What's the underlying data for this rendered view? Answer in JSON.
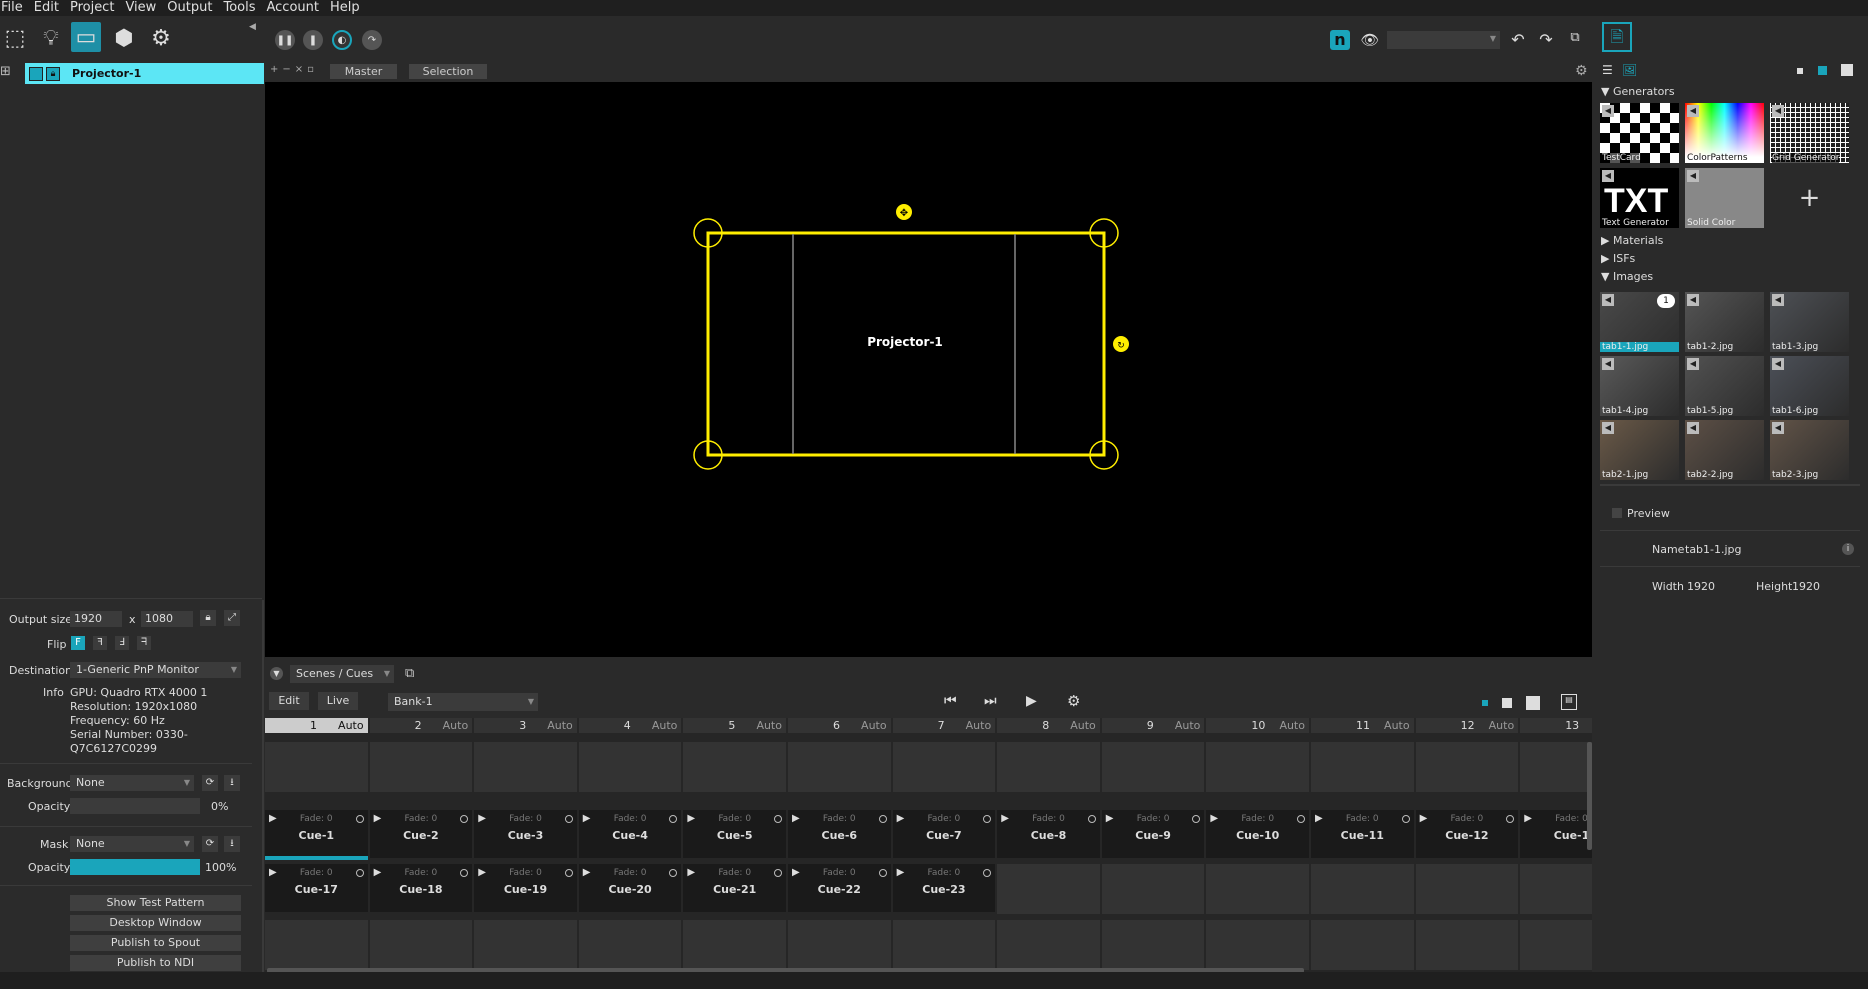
{
  "menu": [
    "File",
    "Edit",
    "Project",
    "View",
    "Output",
    "Tools",
    "Account",
    "Help"
  ],
  "layer": {
    "name": "Projector-1"
  },
  "viewport": {
    "tabs": [
      "Master",
      "Selection"
    ],
    "projector_label": "Projector-1"
  },
  "output": {
    "size_label": "Output size",
    "width": "1920",
    "x": "x",
    "height": "1080",
    "flip_label": "Flip",
    "destination_label": "Destination",
    "destination_value": "1-Generic PnP Monitor",
    "info_label": "Info",
    "info_lines": [
      "GPU: Quadro RTX 4000 1",
      "Resolution: 1920x1080",
      "Frequency: 60 Hz",
      "Serial Number: 0330-",
      "Q7C6127C0299"
    ],
    "background_label": "Background",
    "background_value": "None",
    "opacity_label": "Opacity",
    "background_opacity": "0%",
    "background_opacity_value": 0,
    "mask_label": "Mask",
    "mask_value": "None",
    "mask_opacity_label": "Opacity",
    "mask_opacity": "100%",
    "mask_opacity_value": 100,
    "buttons": [
      "Show Test Pattern",
      "Desktop Window",
      "Publish to Spout",
      "Publish to NDI"
    ]
  },
  "library": {
    "generators_label": "Generators",
    "generators": [
      "TestCard",
      "ColorPatterns",
      "Grid Generator",
      "Text Generator",
      "Solid Color"
    ],
    "txt": "TXT",
    "add": "+",
    "materials_label": "Materials",
    "isfs_label": "ISFs",
    "images_label": "Images",
    "images": [
      "tab1-1.jpg",
      "tab1-2.jpg",
      "tab1-3.jpg",
      "tab1-4.jpg",
      "tab1-5.jpg",
      "tab1-6.jpg",
      "tab2-1.jpg",
      "tab2-2.jpg",
      "tab2-3.jpg"
    ],
    "badge": "1",
    "preview_label": "Preview",
    "name_label": "Name",
    "name_value": "tab1-1.jpg",
    "width_label": "Width",
    "width_value": "1920",
    "height_label": "Height",
    "height_value": "1920"
  },
  "scenes": {
    "dropdown": "Scenes / Cues",
    "edit": "Edit",
    "live": "Live",
    "bank": "Bank-1",
    "columns": [
      "1",
      "2",
      "3",
      "4",
      "5",
      "6",
      "7",
      "8",
      "9",
      "10",
      "11",
      "12",
      "13"
    ],
    "auto": "Auto",
    "fade": "Fade: 0",
    "row1": [
      "Cue-1",
      "Cue-2",
      "Cue-3",
      "Cue-4",
      "Cue-5",
      "Cue-6",
      "Cue-7",
      "Cue-8",
      "Cue-9",
      "Cue-10",
      "Cue-11",
      "Cue-12",
      "Cue-1"
    ],
    "row2": [
      "Cue-17",
      "Cue-18",
      "Cue-19",
      "Cue-20",
      "Cue-21",
      "Cue-22",
      "Cue-23"
    ]
  },
  "colors": {
    "accent": "#1aa5bb",
    "layer": "#5ce6f5",
    "yellow": "#ffee00"
  }
}
